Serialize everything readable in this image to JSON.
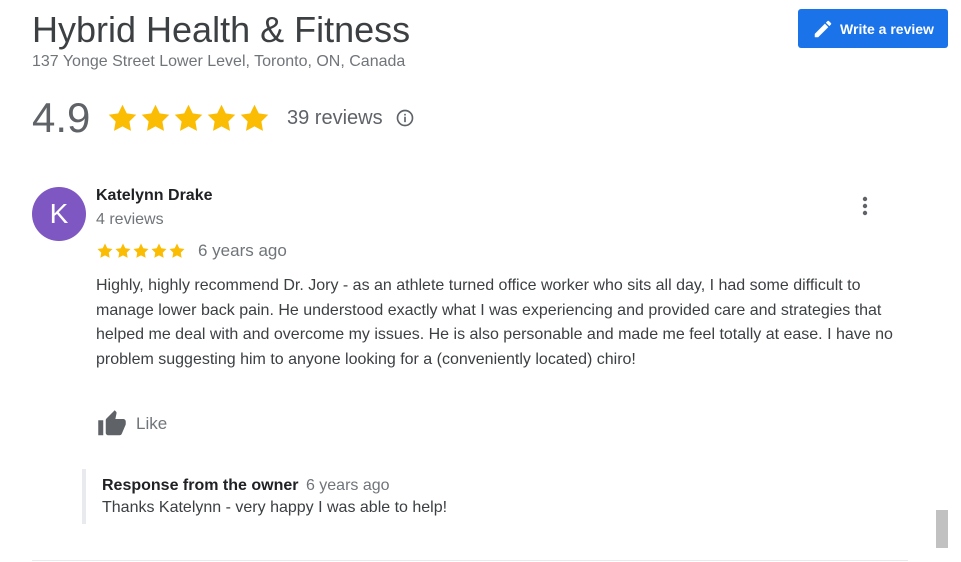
{
  "business": {
    "name": "Hybrid Health & Fitness",
    "address": "137 Yonge Street Lower Level, Toronto, ON, Canada"
  },
  "actions": {
    "write_review_label": "Write a review",
    "write_review_icon": "pencil-icon"
  },
  "summary": {
    "rating": "4.9",
    "rating_value": 4.9,
    "stars_filled": 5,
    "review_count": "39 reviews",
    "info_icon": "info-icon"
  },
  "review": {
    "avatar_initial": "K",
    "avatar_color": "#7e57c2",
    "reviewer_name": "Katelynn Drake",
    "reviewer_meta": "4 reviews",
    "stars": 5,
    "time": "6 years ago",
    "text": "Highly, highly recommend Dr. Jory - as an athlete turned office worker who sits all day, I had some difficult to manage lower back pain. He understood exactly what I was experiencing and provided care and strategies that helped me deal with and overcome my issues. He is also personable and made me feel totally at ease. I have no problem suggesting him to anyone looking for a (conveniently located) chiro!",
    "like_label": "Like",
    "like_icon": "thumbs-up-icon",
    "more_icon": "more-vertical-icon"
  },
  "owner_response": {
    "title": "Response from the owner",
    "time": "6 years ago",
    "text": "Thanks Katelynn - very happy I was able to help!"
  },
  "colors": {
    "accent": "#1a73e8",
    "star": "#fbbc04",
    "muted_text": "#70757a"
  }
}
